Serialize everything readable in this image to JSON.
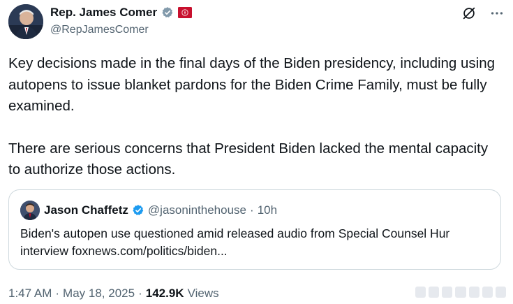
{
  "author": {
    "display_name": "Rep. James Comer",
    "handle": "@RepJamesComer",
    "verified_icon": "verified-badge-icon",
    "flag_icon": "house-seal-flag-icon"
  },
  "tweet": {
    "paragraph_1": "Key decisions made in the final days of the Biden presidency, including using autopens to issue blanket pardons for the Biden Crime Family, must be fully examined.",
    "paragraph_2": "There are serious concerns that President Biden lacked the mental capacity to authorize those actions."
  },
  "quoted_post": {
    "display_name": "Jason Chaffetz",
    "handle": "@jasoninthehouse",
    "separator": "·",
    "time": "10h",
    "text_before_link": "Biden's autopen use questioned amid released audio from Special Counsel Hur interview ",
    "link_text": "foxnews.com/politics/biden..."
  },
  "meta": {
    "time": "1:47 AM",
    "separator_1": "·",
    "date": "May 18, 2025",
    "separator_2": "·",
    "views_count": "142.9K",
    "views_label": "Views"
  },
  "colors": {
    "text_primary": "#0f1419",
    "text_secondary": "#536471",
    "verified_blue": "#1d9bf0",
    "border": "#cfd9de"
  }
}
